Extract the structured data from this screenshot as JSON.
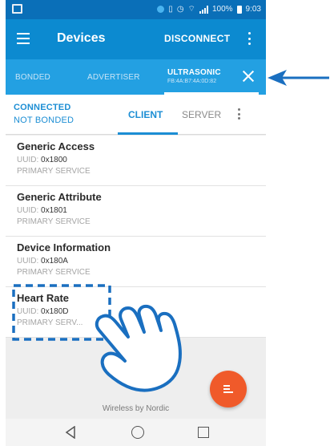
{
  "status_bar": {
    "battery_percent": "100%",
    "time": "9:03"
  },
  "app_bar": {
    "title": "Devices",
    "disconnect_label": "DISCONNECT"
  },
  "device_tabs": {
    "bonded_label": "BONDED",
    "advertiser_label": "ADVERTISER",
    "active": {
      "name": "ULTRASONIC",
      "address": "FB:4A:B7:4A:0D:82"
    }
  },
  "connection": {
    "state": "CONNECTED",
    "bond_state": "NOT BONDED",
    "client_tab": "CLIENT",
    "server_tab": "SERVER"
  },
  "services": [
    {
      "name": "Generic Access",
      "uuid_label": "UUID:",
      "uuid": "0x1800",
      "type": "PRIMARY SERVICE"
    },
    {
      "name": "Generic Attribute",
      "uuid_label": "UUID:",
      "uuid": "0x1801",
      "type": "PRIMARY SERVICE"
    },
    {
      "name": "Device Information",
      "uuid_label": "UUID:",
      "uuid": "0x180A",
      "type": "PRIMARY SERVICE"
    },
    {
      "name": "Heart Rate",
      "uuid_label": "UUID:",
      "uuid": "0x180D",
      "type": "PRIMARY SERV..."
    }
  ],
  "footer": {
    "brand_text": "Wireless by Nordic"
  },
  "colors": {
    "status_bar": "#0a6fb8",
    "app_bar": "#0c8ad0",
    "tab_bar": "#23a0e2",
    "accent": "#1c8ed4",
    "fab": "#f05a2a",
    "annotation": "#1a6fc0"
  },
  "icons": {
    "menu": "hamburger-icon",
    "overflow": "more-vert-icon",
    "close": "close-icon",
    "fab": "log-icon",
    "nav_back": "back-triangle-icon",
    "nav_home": "home-circle-icon",
    "nav_recent": "recents-square-icon",
    "pointer": "tap-hand-icon",
    "arrow": "left-arrow-icon"
  }
}
